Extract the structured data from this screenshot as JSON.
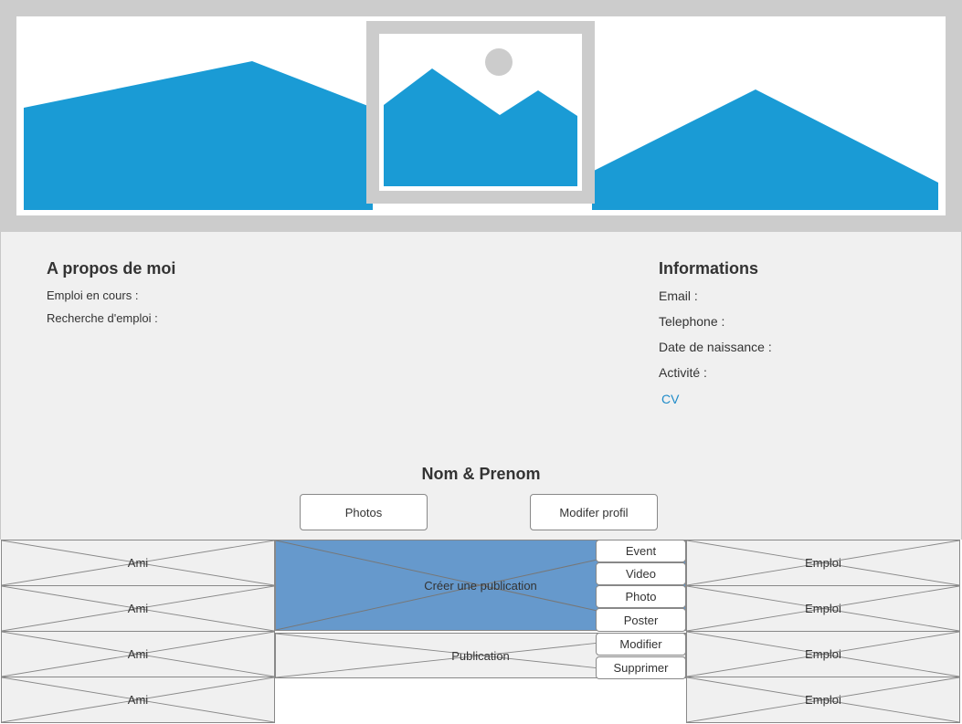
{
  "about": {
    "title": "A propos de moi",
    "current_job_label": "Emploi en cours :",
    "job_search_label": "Recherche d'emploi :"
  },
  "informations": {
    "title": "Informations",
    "email_label": "Email :",
    "phone_label": "Telephone :",
    "birthdate_label": "Date de naissance :",
    "activity_label": "Activité :",
    "cv_link": "CV"
  },
  "profile": {
    "name": "Nom & Prenom",
    "photos_button": "Photos",
    "edit_button": "Modifer profil"
  },
  "friends": [
    "Ami",
    "Ami",
    "Ami",
    "Ami"
  ],
  "jobs": [
    "Emploi",
    "Emploi",
    "Emploi",
    "Emploi"
  ],
  "create_publication": {
    "label": "Créer une publication",
    "options": [
      "Event",
      "Video",
      "Photo",
      "Poster"
    ]
  },
  "publication": {
    "label": "Publication",
    "edit_label": "Modifier",
    "delete_label": "Supprimer"
  },
  "colors": {
    "banner_frame": "#cccccc",
    "image_blue": "#1a9bd5",
    "panel_bg": "#f0f0f0",
    "create_publication_bg": "#6699cc",
    "link": "#1e8bc9"
  },
  "icons": {
    "banner": "image-placeholder-icon",
    "avatar": "image-placeholder-icon"
  }
}
